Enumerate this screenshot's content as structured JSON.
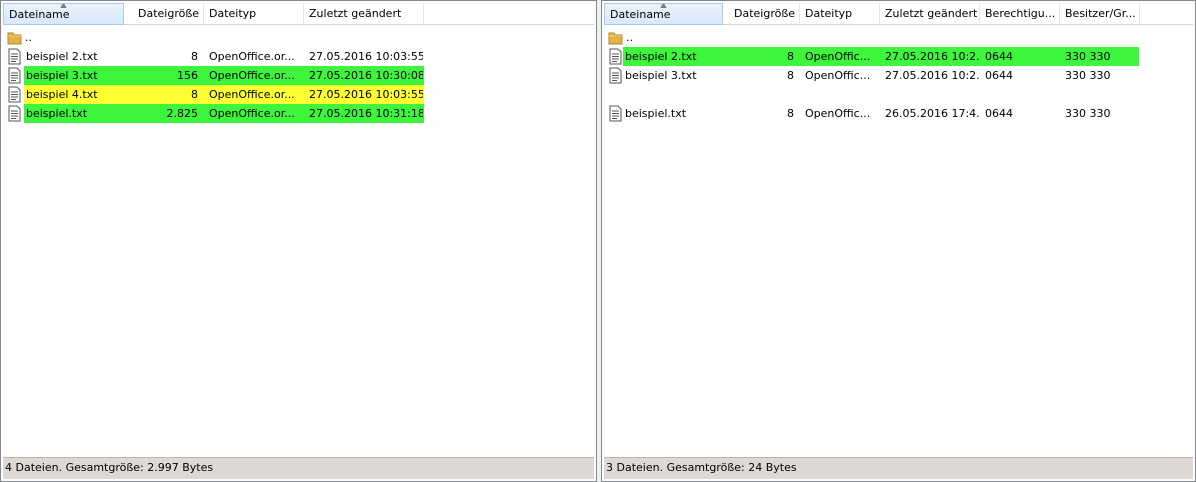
{
  "colors": {
    "match_green": "#3cf53c",
    "diff_yellow": "#ffff33",
    "sorted_header": "#d8e9f9"
  },
  "left": {
    "headers": [
      "Dateiname",
      "Dateigröße",
      "Dateityp",
      "Zuletzt geändert"
    ],
    "parent_dir": "..",
    "files": [
      {
        "name": "beispiel 2.txt",
        "size": "8",
        "type": "OpenOffice.or...",
        "modified": "27.05.2016 10:03:55",
        "highlight": "none"
      },
      {
        "name": "beispiel 3.txt",
        "size": "156",
        "type": "OpenOffice.or...",
        "modified": "27.05.2016 10:30:08",
        "highlight": "green"
      },
      {
        "name": "beispiel 4.txt",
        "size": "8",
        "type": "OpenOffice.or...",
        "modified": "27.05.2016 10:03:55",
        "highlight": "yellow"
      },
      {
        "name": "beispiel.txt",
        "size": "2.825",
        "type": "OpenOffice.or...",
        "modified": "27.05.2016 10:31:18",
        "highlight": "green"
      }
    ],
    "status": "4 Dateien. Gesamtgröße: 2.997 Bytes"
  },
  "right": {
    "headers": [
      "Dateiname",
      "Dateigröße",
      "Dateityp",
      "Zuletzt geändert",
      "Berechtigu...",
      "Besitzer/Gr..."
    ],
    "parent_dir": "..",
    "files": [
      {
        "name": "beispiel 2.txt",
        "size": "8",
        "type": "OpenOffic...",
        "modified": "27.05.2016 10:2...",
        "perm": "0644",
        "owner": "330 330",
        "highlight": "green"
      },
      {
        "name": "beispiel 3.txt",
        "size": "8",
        "type": "OpenOffic...",
        "modified": "27.05.2016 10:2...",
        "perm": "0644",
        "owner": "330 330",
        "highlight": "none"
      },
      {
        "name": "beispiel.txt",
        "size": "8",
        "type": "OpenOffic...",
        "modified": "26.05.2016 17:4...",
        "perm": "0644",
        "owner": "330 330",
        "highlight": "none"
      }
    ],
    "status": "3 Dateien. Gesamtgröße: 24 Bytes"
  },
  "icons": {
    "folder": "folder-icon",
    "file": "text-file-icon",
    "sort": "sort-ascending-icon"
  }
}
